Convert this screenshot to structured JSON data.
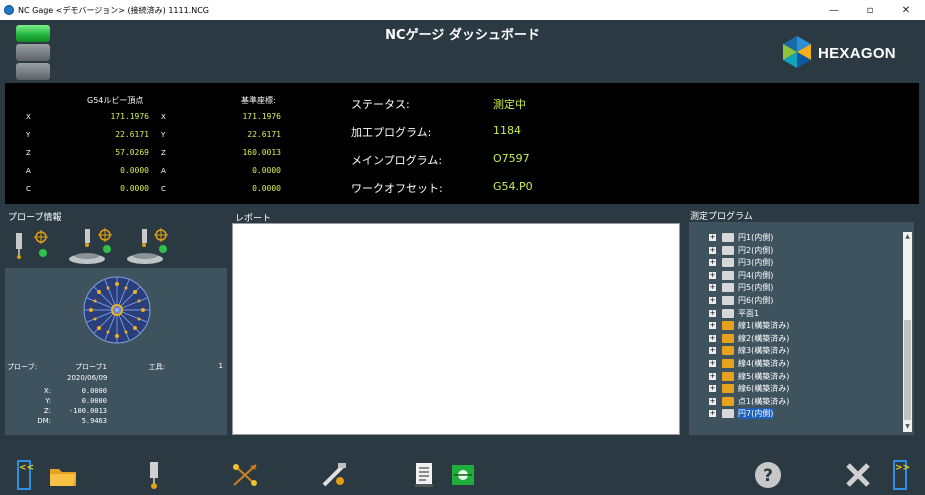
{
  "window": {
    "title": "NC Gage <デモバージョン> (接続済み) 1111.NCG",
    "minimize": "—",
    "maximize": "▫",
    "close": "✕"
  },
  "header": {
    "title": "NCゲージ ダッシュボード",
    "logo_text": "HEXAGON"
  },
  "coords": {
    "g54_header": "G54ルビー頂点",
    "base_header": "基準座標:",
    "rows": [
      {
        "axis": "X",
        "g54": "171.1976",
        "base_axis": "X",
        "base": "171.1976"
      },
      {
        "axis": "Y",
        "g54": "22.6171",
        "base_axis": "Y",
        "base": "22.6171"
      },
      {
        "axis": "Z",
        "g54": "57.0269",
        "base_axis": "Z",
        "base": "160.0013"
      },
      {
        "axis": "A",
        "g54": "0.0000",
        "base_axis": "A",
        "base": "0.0000"
      },
      {
        "axis": "C",
        "g54": "0.0000",
        "base_axis": "C",
        "base": "0.0000"
      }
    ]
  },
  "status": {
    "rows": [
      {
        "label": "ステータス:",
        "value": "測定中"
      },
      {
        "label": "加工プログラム:",
        "value": "1184"
      },
      {
        "label": "メインプログラム:",
        "value": "O7597"
      },
      {
        "label": "ワークオフセット:",
        "value": "G54.P0"
      }
    ]
  },
  "probe_info": {
    "title": "プローブ情報",
    "probe_label": "プローブ:",
    "probe_value": "プローブ1",
    "tool_label": "工具:",
    "tool_value": "1",
    "date": "2020/06/09",
    "x_label": "X:",
    "x_value": "0.0000",
    "y_label": "Y:",
    "y_value": "0.0000",
    "z_label": "Z:",
    "z_value": "-100.0013",
    "dm_label": "DM:",
    "dm_value": "5.9463"
  },
  "report": {
    "title": "レポート"
  },
  "programs": {
    "title": "測定プログラム",
    "items": [
      {
        "name": "円1(内側)",
        "type": "circle"
      },
      {
        "name": "円2(内側)",
        "type": "circle"
      },
      {
        "name": "円3(内側)",
        "type": "circle"
      },
      {
        "name": "円4(内側)",
        "type": "circle"
      },
      {
        "name": "円5(内側)",
        "type": "circle"
      },
      {
        "name": "円6(内側)",
        "type": "circle"
      },
      {
        "name": "平面1",
        "type": "plane"
      },
      {
        "name": "線1(構築済み)",
        "type": "folder"
      },
      {
        "name": "線2(構築済み)",
        "type": "folder"
      },
      {
        "name": "線3(構築済み)",
        "type": "folder"
      },
      {
        "name": "線4(構築済み)",
        "type": "folder"
      },
      {
        "name": "線5(構築済み)",
        "type": "folder"
      },
      {
        "name": "線6(構築済み)",
        "type": "folder"
      },
      {
        "name": "点1(構築済み)",
        "type": "folder"
      },
      {
        "name": "円7(内側)",
        "type": "circle",
        "selected": true
      }
    ],
    "expand_glyph": "+"
  },
  "toolbar": {
    "collapse_left": "<<",
    "collapse_right": ">>",
    "help": "?",
    "close": "✕"
  },
  "colors": {
    "background": "#2b3a42",
    "panel": "#3e535e",
    "value_text": "#d8f050",
    "status_value": "#c8f050",
    "light_green": "#32d04a",
    "selected": "#1e5fb8",
    "accent_blue": "#2f8fe0"
  }
}
